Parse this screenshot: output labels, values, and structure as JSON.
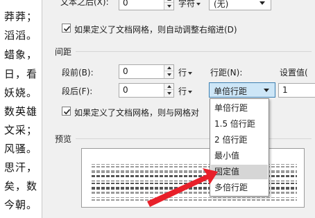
{
  "document": {
    "lines": [
      "莽莽；",
      "滔滔。",
      "蜡象，",
      "日，看",
      "妖娆。",
      "数英雄",
      "文采；",
      "风骚。",
      "思汗，",
      "矣，数",
      "今朝。"
    ]
  },
  "indent": {
    "after_text_label": "文本之后(X):",
    "after_text_value": "0",
    "after_text_unit": "字符",
    "special_value": "(无)",
    "auto_adjust_checkbox_label": "如果定义了文档网格，则自动调整右缩进(D)",
    "auto_adjust_checked": true
  },
  "spacing": {
    "section_title": "间距",
    "before_label": "段前(B):",
    "before_value": "0",
    "before_unit": "行",
    "after_label": "段后(F):",
    "after_value": "0",
    "after_unit": "行",
    "line_spacing_label": "行距(N):",
    "line_spacing_value": "单倍行距",
    "set_value_label": "设置值(",
    "set_value": "1",
    "grid_checkbox_label": "如果定义了文档网格，则与网格对",
    "grid_checked": true
  },
  "preview": {
    "title": "预览"
  },
  "dropdown": {
    "options": [
      "单倍行距",
      "1.5 倍行距",
      "2 倍行距",
      "最小值",
      "固定值",
      "多倍行距"
    ],
    "highlighted_index": 4
  },
  "colors": {
    "annotation_arrow": "#e8202a",
    "dropdown_highlight": "#d6d6d6",
    "combo_active": "#cde6f7"
  }
}
